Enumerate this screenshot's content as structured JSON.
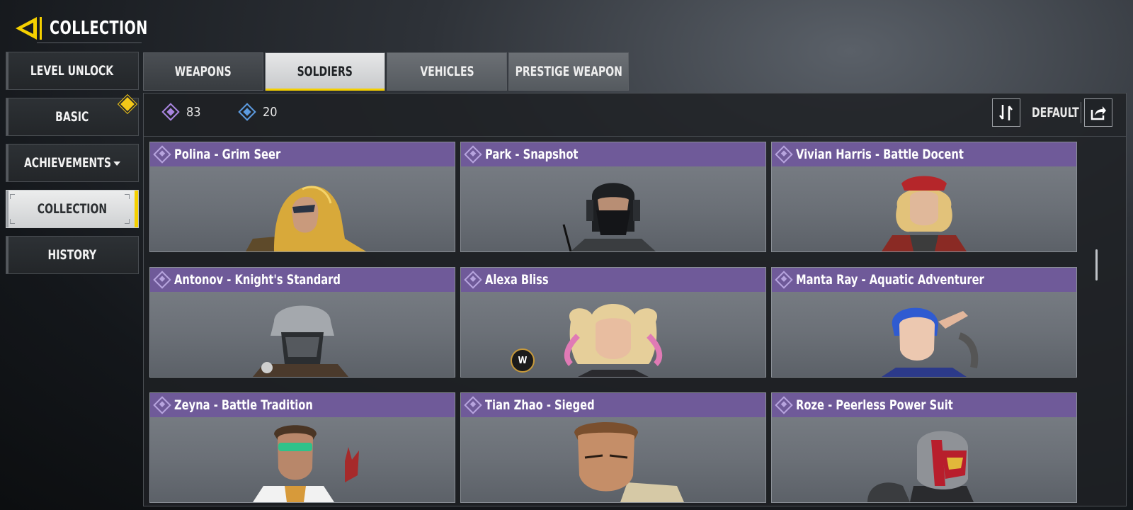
{
  "header": {
    "title": "COLLECTION"
  },
  "sidebar": {
    "items": [
      {
        "label": "LEVEL UNLOCK"
      },
      {
        "label": "BASIC"
      },
      {
        "label": "ACHIEVEMENTS"
      },
      {
        "label": "COLLECTION"
      },
      {
        "label": "HISTORY"
      }
    ]
  },
  "tabs": [
    {
      "label": "WEAPONS"
    },
    {
      "label": "SOLDIERS"
    },
    {
      "label": "VEHICLES"
    },
    {
      "label": "PRESTIGE WEAPON"
    }
  ],
  "toolbar": {
    "currency_purple": "83",
    "currency_blue": "20",
    "sort_label": "DEFAULT"
  },
  "cards": [
    {
      "title": "Polina - Grim Seer"
    },
    {
      "title": "Park - Snapshot"
    },
    {
      "title": "Vivian Harris - Battle Docent"
    },
    {
      "title": "Antonov - Knight's Standard"
    },
    {
      "title": "Alexa Bliss"
    },
    {
      "title": "Manta Ray - Aquatic Adventurer"
    },
    {
      "title": "Zeyna - Battle Tradition"
    },
    {
      "title": "Tian Zhao - Sieged"
    },
    {
      "title": "Roze - Peerless Power Suit"
    }
  ],
  "colors": {
    "accent_yellow": "#f5d000",
    "card_header_purple": "#6f5a99",
    "epic_purple": "#a985e0",
    "rare_blue": "#5c9be0"
  },
  "icons": {
    "back": "back-arrow-icon",
    "sort": "sort-icon",
    "share": "share-icon",
    "badge": "new-badge-diamond-icon",
    "wwe": "wwe-logo"
  },
  "wwe_logo_text": "W"
}
